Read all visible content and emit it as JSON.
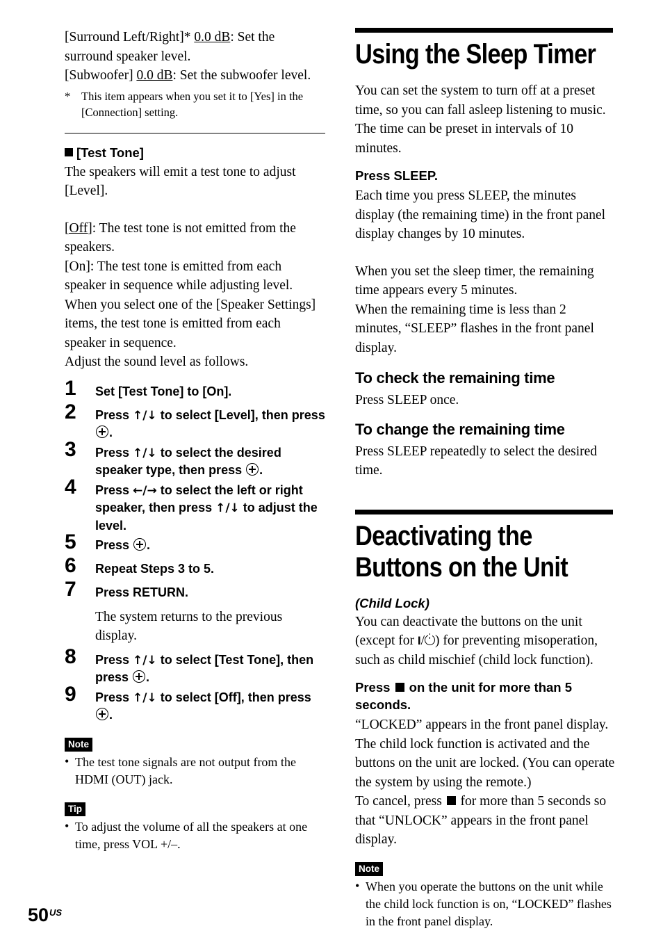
{
  "page": {
    "number": "50",
    "region_suffix": "US"
  },
  "left_column": {
    "speaker_level_lines": [
      {
        "label": "[Surround Left/Right]",
        "asterisk": "*",
        "value": "0.0 dB",
        "desc": ": Set the surround speaker level."
      },
      {
        "label": "[Subwoofer]",
        "asterisk": "",
        "value": "0.0 dB",
        "desc": ": Set the subwoofer level."
      }
    ],
    "footnote": {
      "mark": "*",
      "text": "This item appears when you set it to [Yes] in the [Connection] setting."
    },
    "test_tone": {
      "heading": "[Test Tone]",
      "intro": "The speakers will emit a test tone to adjust [Level].",
      "option_off_label": "[Off]",
      "option_off_desc": ": The test tone is not emitted from the speakers.",
      "option_on": "[On]: The test tone is emitted from each speaker in sequence while adjusting level. When you select one of the [Speaker Settings] items, the test tone is emitted from each speaker in sequence.",
      "adjust_line": "Adjust the sound level as follows."
    },
    "steps": [
      {
        "num": "1",
        "text_parts": [
          {
            "t": "Set [Test Tone] to [On]."
          }
        ]
      },
      {
        "num": "2",
        "text_parts": [
          {
            "t": "Press "
          },
          {
            "icon": "up-down-arrows",
            "t": "↑/↓"
          },
          {
            "t": " to select [Level], then press "
          },
          {
            "icon": "enter-button",
            "t": ""
          },
          {
            "t": "."
          }
        ]
      },
      {
        "num": "3",
        "text_parts": [
          {
            "t": "Press "
          },
          {
            "icon": "up-down-arrows",
            "t": "↑/↓"
          },
          {
            "t": " to select the desired speaker type, then press "
          },
          {
            "icon": "enter-button",
            "t": ""
          },
          {
            "t": "."
          }
        ]
      },
      {
        "num": "4",
        "text_parts": [
          {
            "t": "Press "
          },
          {
            "icon": "left-right-arrows",
            "t": "←/→"
          },
          {
            "t": " to select the left or right speaker, then press "
          },
          {
            "icon": "up-down-arrows",
            "t": "↑/↓"
          },
          {
            "t": " to adjust the level."
          }
        ]
      },
      {
        "num": "5",
        "text_parts": [
          {
            "t": "Press "
          },
          {
            "icon": "enter-button",
            "t": ""
          },
          {
            "t": "."
          }
        ]
      },
      {
        "num": "6",
        "text_parts": [
          {
            "t": "Repeat Steps 3 to 5."
          }
        ]
      },
      {
        "num": "7",
        "text_parts": [
          {
            "t": "Press RETURN."
          }
        ],
        "sub": "The system returns to the previous display."
      },
      {
        "num": "8",
        "text_parts": [
          {
            "t": "Press "
          },
          {
            "icon": "up-down-arrows",
            "t": "↑/↓"
          },
          {
            "t": " to select [Test Tone], then press "
          },
          {
            "icon": "enter-button",
            "t": ""
          },
          {
            "t": "."
          }
        ]
      },
      {
        "num": "9",
        "text_parts": [
          {
            "t": "Press "
          },
          {
            "icon": "up-down-arrows",
            "t": "↑/↓"
          },
          {
            "t": " to select [Off], then press "
          },
          {
            "icon": "enter-button",
            "t": ""
          },
          {
            "t": "."
          }
        ]
      }
    ],
    "note": {
      "badge": "Note",
      "bullet": "The test tone signals are not output from the HDMI (OUT) jack."
    },
    "tip": {
      "badge": "Tip",
      "bullet": "To adjust the volume of all the speakers at one time, press VOL +/–."
    }
  },
  "right_column": {
    "sleep_timer": {
      "title": "Using the Sleep Timer",
      "intro": "You can set the system to turn off at a preset time, so you can fall asleep listening to music. The time can be preset in intervals of 10 minutes.",
      "press_sleep_heading": "Press SLEEP.",
      "press_sleep_body": "Each time you press SLEEP, the minutes display (the remaining time) in the front panel display changes by 10 minutes.",
      "remaining_para_1": "When you set the sleep timer, the remaining time appears every 5 minutes.",
      "remaining_para_2": "When the remaining time is less than 2 minutes, “SLEEP” flashes in the front panel display.",
      "check_heading": "To check the remaining time",
      "check_body": "Press SLEEP once.",
      "change_heading": "To change the remaining time",
      "change_body": "Press SLEEP repeatedly to select the desired time."
    },
    "child_lock": {
      "title": "Deactivating the Buttons on the Unit",
      "subtitle": "(Child Lock)",
      "intro_before_icon": "You can deactivate the buttons on the unit (except for ",
      "intro_after_icon": ") for preventing misoperation, such as child mischief (child lock function).",
      "press_heading_before": "Press ",
      "press_heading_after": " on the unit for more than 5 seconds.",
      "body_1": "“LOCKED” appears in the front panel display. The child lock function is activated and the buttons on the unit are locked. (You can operate the system by using the remote.)",
      "body_2_before": "To cancel, press ",
      "body_2_after": " for more than 5 seconds so that “UNLOCK” appears in the front panel display.",
      "note": {
        "badge": "Note",
        "bullet": "When you operate the buttons on the unit while the child lock function is on, “LOCKED” flashes in the front panel display."
      }
    }
  }
}
